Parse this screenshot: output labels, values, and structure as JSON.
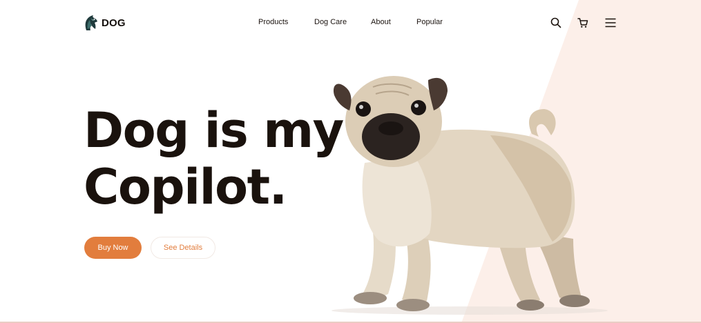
{
  "brand": {
    "name": "DOG"
  },
  "nav": {
    "links": [
      "Products",
      "Dog Care",
      "About",
      "Popular"
    ],
    "icons": [
      "search-icon",
      "cart-icon",
      "menu-icon"
    ]
  },
  "hero": {
    "title_line1": "Dog is my",
    "title_line2": "Copilot.",
    "primary_button": "Buy Now",
    "secondary_button": "See Details"
  },
  "colors": {
    "accent": "#e27d3d",
    "diagonal_bg": "#fcefe9",
    "text_dark": "#1a120d"
  }
}
